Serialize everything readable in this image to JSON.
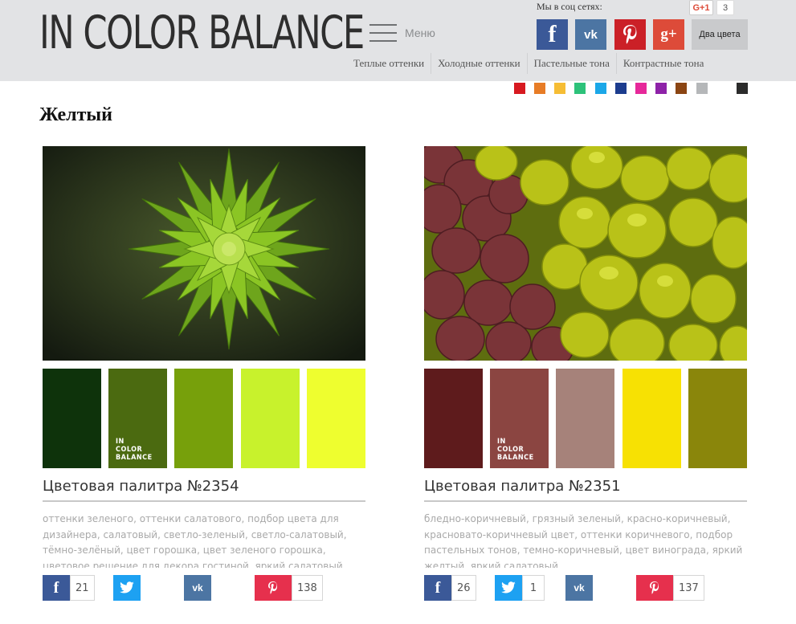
{
  "header": {
    "logo": "IN COLOR BALANCE",
    "menu_label": "Меню",
    "social_title": "Мы в соц сетях:",
    "gplus_label": "G+1",
    "gplus_count": "3",
    "two_colors": "Два цвета",
    "nav": [
      "Теплые оттенки",
      "Холодные оттенки",
      "Пастельные тона",
      "Контрастные тона"
    ]
  },
  "color_filters": [
    "#d71920",
    "#e77c26",
    "#f6bd34",
    "#2dc27a",
    "#1ba7e8",
    "#1c3c8e",
    "#e6289a",
    "#8e22a8",
    "#8b4513",
    "#b5b7b9",
    "#ffffff",
    "#2b2b2b"
  ],
  "page_title": "Желтый",
  "watermark": [
    "IN",
    "COLOR",
    "BALANCE"
  ],
  "cards": [
    {
      "title": "Цветовая палитра №2354",
      "colors": [
        "#0e330b",
        "#4b6a10",
        "#77a00b",
        "#c8f22c",
        "#eefe2f"
      ],
      "tags": "оттенки зеленого, оттенки салатового, подбор цвета для дизайнера, салатовый, светло-зеленый, светло-салатовый, тёмно-зелёный, цвет горошка, цвет зеленого горошка, цветовое решение для декора гостиной, яркий салатовый",
      "share": {
        "facebook": "21",
        "twitter": "",
        "vk": "",
        "pinterest": "138"
      }
    },
    {
      "title": "Цветовая палитра №2351",
      "colors": [
        "#5e1b1c",
        "#8b4541",
        "#a6827a",
        "#f7e103",
        "#8a860b"
      ],
      "tags": "бледно-коричневый, грязный зеленый, красно-коричневый, красновато-коричневый цвет, оттенки коричневого, подбор пастельных тонов, темно-коричневый, цвет винограда, яркий желтый, яркий салатовый",
      "share": {
        "facebook": "26",
        "twitter": "1",
        "vk": "",
        "pinterest": "137"
      }
    }
  ]
}
